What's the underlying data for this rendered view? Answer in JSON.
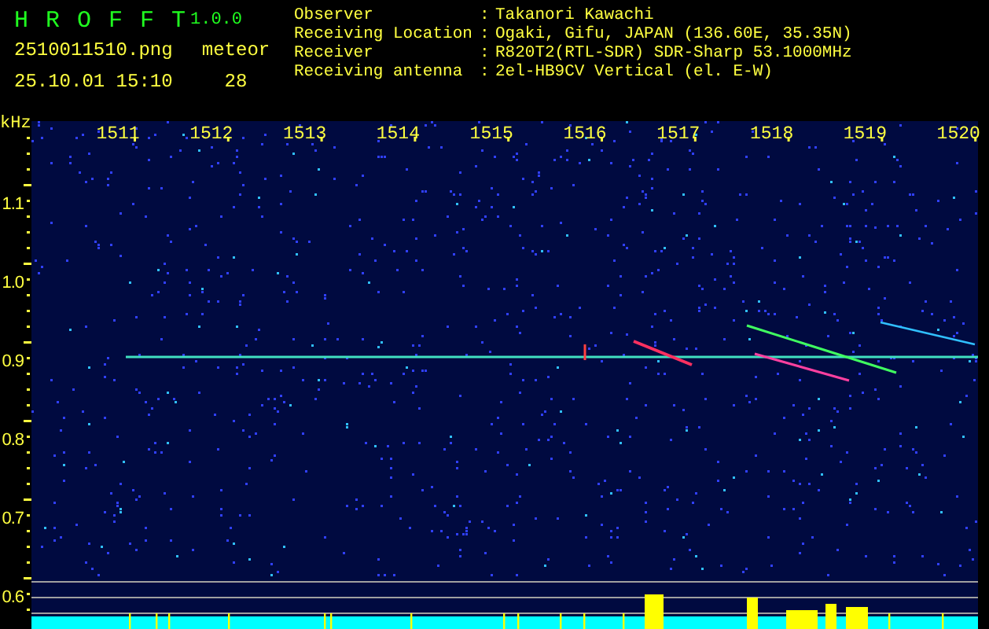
{
  "app": {
    "name": "H R O F F T",
    "version": "1.0.0"
  },
  "file": "2510011510.png",
  "datetime": "25.10.01 15:10",
  "meteor": {
    "label": "meteor",
    "count": "28"
  },
  "info": [
    {
      "label": "Observer",
      "sep": ":",
      "value": "Takanori Kawachi"
    },
    {
      "label": "Receiving Location",
      "sep": ":",
      "value": "Ogaki, Gifu, JAPAN (136.60E, 35.35N)"
    },
    {
      "label": "Receiver",
      "sep": ":",
      "value": "R820T2(RTL-SDR) SDR-Sharp 53.1000MHz"
    },
    {
      "label": "Receiving antenna",
      "sep": ":",
      "value": "2el-HB9CV Vertical (el. E-W)"
    }
  ],
  "plot": {
    "unit": "kHz",
    "x_ticks": [
      "1511",
      "1512",
      "1513",
      "1514",
      "1515",
      "1516",
      "1517",
      "1518",
      "1519",
      "1520"
    ],
    "y_ticks": [
      "1.1",
      "1.0",
      "0.9",
      "0.8",
      "0.7",
      "0.6"
    ]
  }
}
